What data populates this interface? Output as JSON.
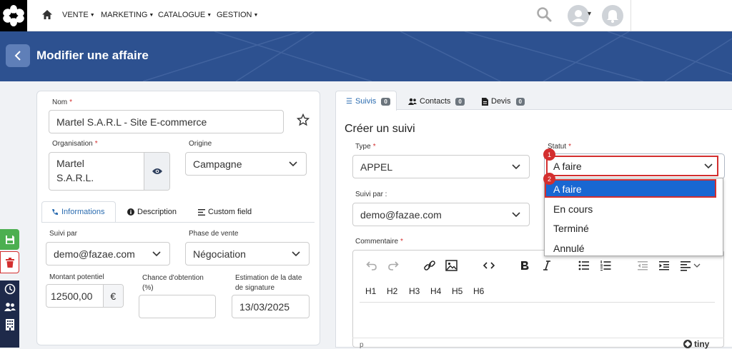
{
  "nav": {
    "menus": [
      "VENTE",
      "MARKETING",
      "CATALOGUE",
      "GESTION"
    ]
  },
  "header": {
    "title": "Modifier une affaire"
  },
  "left": {
    "nom_label": "Nom",
    "nom_value": "Martel S.A.R.L - Site E-commerce",
    "org_label": "Organisation",
    "org_value_line1": "Martel",
    "org_value_line2": "S.A.R.L.",
    "origine_label": "Origine",
    "origine_value": "Campagne",
    "tabs": [
      "Informations",
      "Description",
      "Custom field"
    ],
    "suivi_label": "Suivi par",
    "suivi_value": "demo@fazae.com",
    "phase_label": "Phase de vente",
    "phase_value": "Négociation",
    "montant_label": "Montant potentiel",
    "montant_value": "12500,00",
    "currency": "€",
    "chance_label_line1": "Chance d'obtention",
    "chance_label_line2": "(%)",
    "chance_value": "",
    "estim_label_line1": "Estimation de la date",
    "estim_label_line2": "de signature",
    "estim_value": "13/03/2025"
  },
  "right": {
    "tabs": [
      {
        "label": "Suivis",
        "count": "0"
      },
      {
        "label": "Contacts",
        "count": "0"
      },
      {
        "label": "Devis",
        "count": "0"
      }
    ],
    "heading": "Créer un suivi",
    "type_label": "Type",
    "type_value": "APPEL",
    "statut_label": "Statut",
    "statut_value": "A faire",
    "suivipar_label": "Suivi par :",
    "suivipar_value": "demo@fazae.com",
    "comment_label": "Commentaire",
    "status_options": [
      "A faire",
      "En cours",
      "Terminé",
      "Annulé"
    ],
    "headings": [
      "H1",
      "H2",
      "H3",
      "H4",
      "H5",
      "H6"
    ],
    "status_path": "p",
    "brand": "tiny"
  },
  "annotations": {
    "step1": "1",
    "step2": "2"
  },
  "colors": {
    "banner": "#2d5190",
    "accent": "#2b6cb0",
    "highlight": "#d32f2f",
    "save": "#4caf50",
    "delete": "#d32f2f",
    "side": "#1e2a4a"
  }
}
